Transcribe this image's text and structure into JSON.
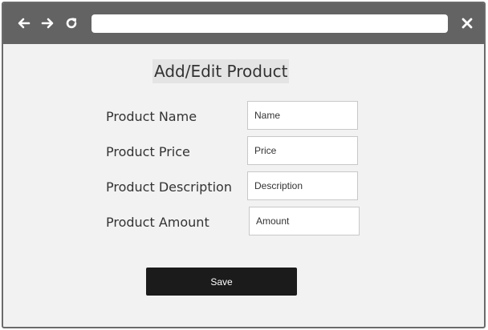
{
  "browser": {
    "address_value": "",
    "icons": {
      "back": "arrow-left-icon",
      "forward": "arrow-right-icon",
      "reload": "reload-icon",
      "close": "close-icon"
    }
  },
  "form": {
    "title": "Add/Edit Product",
    "fields": [
      {
        "label": "Product Name",
        "placeholder": "Name"
      },
      {
        "label": "Product Price",
        "placeholder": "Price"
      },
      {
        "label": "Product Description",
        "placeholder": "Description"
      },
      {
        "label": "Product Amount",
        "placeholder": "Amount"
      }
    ],
    "save_label": "Save"
  },
  "colors": {
    "toolbar": "#636363",
    "page_background": "#f2f2f2",
    "button": "#1b1b1b"
  }
}
